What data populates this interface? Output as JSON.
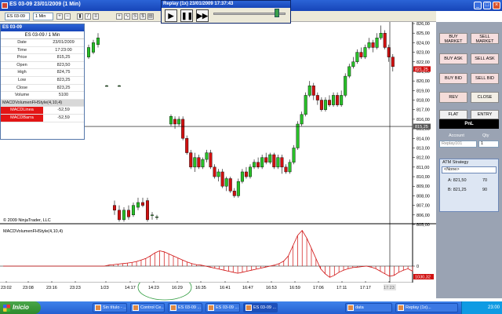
{
  "window": {
    "title": "ES 03-09  23/01/2009  (1 Min)"
  },
  "toolbar": {
    "instrument": "ES 03-09",
    "interval": "1 Min"
  },
  "replay": {
    "title": "Replay (1x) 23/01/2009 17:37:43",
    "progress": 0.85
  },
  "databox": {
    "title": "ES 03-09",
    "subtitle": "ES 03-09 / 1 Min",
    "rows": [
      {
        "k": "Date",
        "v": "23/01/2009"
      },
      {
        "k": "Time",
        "v": "17:23:00"
      },
      {
        "k": "Price",
        "v": "815,25"
      },
      {
        "k": "Open",
        "v": "823,50"
      },
      {
        "k": "High",
        "v": "824,75"
      },
      {
        "k": "Low",
        "v": "823,25"
      },
      {
        "k": "Close",
        "v": "823,25"
      },
      {
        "k": "Volume",
        "v": "5100"
      },
      {
        "k": "MACDVolumenFHStyle(4,10,4)",
        "v": ""
      },
      {
        "k": "MACDLinea",
        "v": "-52,59"
      },
      {
        "k": "MACDBarra",
        "v": "-52,59"
      }
    ]
  },
  "chart": {
    "copyright": "© 2009 NinjaTrader, LLC",
    "indicator_label": "MACDVolumenFHStyle(4,10,4)",
    "price_labels": [
      "826,00",
      "825,00",
      "824,00",
      "823,00",
      "822,00",
      "821,00",
      "820,00",
      "819,00",
      "818,00",
      "817,00",
      "816,00",
      "815,00",
      "814,00",
      "813,00",
      "812,00",
      "811,00",
      "810,00",
      "809,00",
      "808,00",
      "807,00",
      "806,00",
      "805,00"
    ],
    "current_price_tag": "821,25",
    "crosshair_price_tag": "815,25",
    "indicator_tag": "1030,32",
    "indicator_zero_label": "0",
    "time_labels": [
      "23:02",
      "23:08",
      "23:16",
      "23:23",
      "1/23",
      "14:17",
      "14:23",
      "16:29",
      "16:35",
      "16:41",
      "16:47",
      "16:53",
      "16:59",
      "17:06",
      "17:11",
      "17:17",
      "17:23"
    ]
  },
  "chart_data": {
    "type": "candlestick",
    "ylim": [
      805,
      826
    ],
    "candles": [
      {
        "o": 822.5,
        "c": 823.5,
        "h": 823.8,
        "l": 822.3
      },
      {
        "o": 823.0,
        "c": 824.0,
        "h": 824.3,
        "l": 822.8
      },
      {
        "o": 823.8,
        "c": 824.5,
        "h": 825.0,
        "l": 823.5
      },
      {
        "o": 819.5,
        "c": 819.5,
        "h": 819.6,
        "l": 819.4
      },
      {
        "o": 819.5,
        "c": 819.5,
        "h": 819.6,
        "l": 819.4
      },
      {
        "o": 807.0,
        "c": 806.5,
        "h": 807.5,
        "l": 806.0
      },
      {
        "o": 806.5,
        "c": 805.5,
        "h": 807.0,
        "l": 805.3
      },
      {
        "o": 805.5,
        "c": 806.5,
        "h": 806.8,
        "l": 805.3
      },
      {
        "o": 806.5,
        "c": 805.8,
        "h": 807.0,
        "l": 805.5
      },
      {
        "o": 806.0,
        "c": 807.0,
        "h": 807.3,
        "l": 805.8
      },
      {
        "o": 806.8,
        "c": 807.3,
        "h": 807.8,
        "l": 806.5
      },
      {
        "o": 807.3,
        "c": 807.0,
        "h": 807.8,
        "l": 806.8
      },
      {
        "o": 807.5,
        "c": 805.5,
        "h": 807.8,
        "l": 805.3
      },
      {
        "o": 806.0,
        "c": 806.0,
        "h": 806.3,
        "l": 805.5
      },
      {
        "o": 805.8,
        "c": 805.8,
        "h": 806.0,
        "l": 805.5
      },
      {
        "o": 815.5,
        "c": 816.3,
        "h": 816.5,
        "l": 815.3
      },
      {
        "o": 816.0,
        "c": 815.5,
        "h": 816.3,
        "l": 815.0
      },
      {
        "o": 815.5,
        "c": 816.0,
        "h": 816.3,
        "l": 815.3
      },
      {
        "o": 816.0,
        "c": 814.0,
        "h": 816.3,
        "l": 813.8
      },
      {
        "o": 814.0,
        "c": 812.5,
        "h": 814.3,
        "l": 812.3
      },
      {
        "o": 812.5,
        "c": 811.0,
        "h": 812.8,
        "l": 810.8
      },
      {
        "o": 811.0,
        "c": 812.0,
        "h": 812.5,
        "l": 810.5
      },
      {
        "o": 812.0,
        "c": 811.0,
        "h": 812.3,
        "l": 810.8
      },
      {
        "o": 811.0,
        "c": 811.8,
        "h": 812.0,
        "l": 810.8
      },
      {
        "o": 811.8,
        "c": 812.5,
        "h": 812.8,
        "l": 811.5
      },
      {
        "o": 812.5,
        "c": 811.0,
        "h": 812.8,
        "l": 810.8
      },
      {
        "o": 811.0,
        "c": 810.0,
        "h": 811.3,
        "l": 809.8
      },
      {
        "o": 810.0,
        "c": 810.5,
        "h": 810.8,
        "l": 809.5
      },
      {
        "o": 810.5,
        "c": 809.0,
        "h": 810.8,
        "l": 808.8
      },
      {
        "o": 809.0,
        "c": 809.8,
        "h": 810.0,
        "l": 808.5
      },
      {
        "o": 809.8,
        "c": 808.5,
        "h": 810.0,
        "l": 808.3
      },
      {
        "o": 808.5,
        "c": 808.0,
        "h": 808.8,
        "l": 807.8
      },
      {
        "o": 808.0,
        "c": 809.5,
        "h": 809.8,
        "l": 807.8
      },
      {
        "o": 809.5,
        "c": 810.5,
        "h": 810.8,
        "l": 809.3
      },
      {
        "o": 810.5,
        "c": 810.0,
        "h": 811.0,
        "l": 809.8
      },
      {
        "o": 810.0,
        "c": 811.0,
        "h": 811.3,
        "l": 809.8
      },
      {
        "o": 811.0,
        "c": 811.5,
        "h": 811.8,
        "l": 810.8
      },
      {
        "o": 811.5,
        "c": 811.0,
        "h": 812.0,
        "l": 810.8
      },
      {
        "o": 811.0,
        "c": 812.0,
        "h": 812.3,
        "l": 810.8
      },
      {
        "o": 812.0,
        "c": 811.5,
        "h": 812.5,
        "l": 811.3
      },
      {
        "o": 811.5,
        "c": 812.3,
        "h": 812.5,
        "l": 811.3
      },
      {
        "o": 812.3,
        "c": 811.0,
        "h": 812.5,
        "l": 810.8
      },
      {
        "o": 811.0,
        "c": 812.0,
        "h": 812.3,
        "l": 810.8
      },
      {
        "o": 812.0,
        "c": 811.0,
        "h": 812.3,
        "l": 810.3
      },
      {
        "o": 811.0,
        "c": 810.5,
        "h": 811.3,
        "l": 810.3
      },
      {
        "o": 810.5,
        "c": 811.5,
        "h": 811.8,
        "l": 810.3
      },
      {
        "o": 811.5,
        "c": 813.0,
        "h": 813.3,
        "l": 811.3
      },
      {
        "o": 813.0,
        "c": 815.5,
        "h": 815.8,
        "l": 812.8
      },
      {
        "o": 815.5,
        "c": 816.5,
        "h": 816.8,
        "l": 815.3
      },
      {
        "o": 816.5,
        "c": 818.5,
        "h": 818.8,
        "l": 816.3
      },
      {
        "o": 818.5,
        "c": 819.5,
        "h": 820.0,
        "l": 818.3
      },
      {
        "o": 819.5,
        "c": 818.5,
        "h": 819.8,
        "l": 818.0
      },
      {
        "o": 818.5,
        "c": 818.0,
        "h": 818.8,
        "l": 817.5
      },
      {
        "o": 818.0,
        "c": 817.0,
        "h": 818.3,
        "l": 816.8
      },
      {
        "o": 817.0,
        "c": 818.0,
        "h": 818.3,
        "l": 816.8
      },
      {
        "o": 818.0,
        "c": 817.5,
        "h": 818.5,
        "l": 817.3
      },
      {
        "o": 817.5,
        "c": 818.5,
        "h": 818.8,
        "l": 817.3
      },
      {
        "o": 818.5,
        "c": 817.5,
        "h": 818.8,
        "l": 817.3
      },
      {
        "o": 817.5,
        "c": 818.5,
        "h": 819.0,
        "l": 817.3
      },
      {
        "o": 818.5,
        "c": 820.5,
        "h": 820.8,
        "l": 818.3
      },
      {
        "o": 820.5,
        "c": 821.5,
        "h": 821.8,
        "l": 820.3
      },
      {
        "o": 821.5,
        "c": 822.0,
        "h": 822.5,
        "l": 821.3
      },
      {
        "o": 822.0,
        "c": 823.0,
        "h": 823.3,
        "l": 821.8
      },
      {
        "o": 823.0,
        "c": 822.5,
        "h": 823.5,
        "l": 822.3
      },
      {
        "o": 822.5,
        "c": 823.5,
        "h": 823.8,
        "l": 822.3
      },
      {
        "o": 823.5,
        "c": 824.0,
        "h": 824.5,
        "l": 823.3
      },
      {
        "o": 824.0,
        "c": 823.5,
        "h": 824.3,
        "l": 823.0
      },
      {
        "o": 823.5,
        "c": 824.5,
        "h": 825.0,
        "l": 823.3
      },
      {
        "o": 824.5,
        "c": 825.0,
        "h": 825.8,
        "l": 824.3
      },
      {
        "o": 825.0,
        "c": 823.5,
        "h": 825.3,
        "l": 823.3
      },
      {
        "o": 823.5,
        "c": 822.5,
        "h": 823.8,
        "l": 822.0
      },
      {
        "o": 822.5,
        "c": 821.5,
        "h": 822.8,
        "l": 821.0
      }
    ],
    "macd": [
      0,
      0,
      0,
      0,
      0,
      0,
      0,
      0,
      0,
      0,
      0,
      0,
      0,
      0,
      0,
      0,
      0,
      0,
      0,
      0,
      0,
      0,
      0,
      2,
      3,
      4,
      5,
      6,
      7,
      9,
      12,
      15,
      20,
      26,
      30,
      28,
      24,
      20,
      16,
      12,
      8,
      5,
      3,
      2,
      0,
      -2,
      -4,
      -6,
      -8,
      -10,
      -12,
      -14,
      -12,
      -10,
      -8,
      -6,
      -4,
      -2,
      0,
      2,
      5,
      10,
      20,
      40,
      60,
      70,
      55,
      35,
      15,
      -5,
      -15,
      -22,
      -18,
      -12,
      -8,
      -5,
      -3,
      -2,
      -1,
      0,
      -2,
      -5,
      -10,
      -15,
      -20,
      -18,
      -12,
      -8,
      -5,
      -10
    ]
  },
  "panel": {
    "buy_market": "BUY\nMARKET",
    "sell_market": "SELL\nMARKET",
    "buy_ask": "BUY ASK",
    "sell_ask": "SELL ASK",
    "buy_bid": "BUY BID",
    "sell_bid": "SELL BID",
    "rev": "REV",
    "close": "CLOSE",
    "flat": "FLAT",
    "entry": "ENTRY",
    "pnl": "PnL",
    "account_label": "Account",
    "qty_label": "Qty",
    "account_value": "Replay101",
    "qty_value": "1",
    "atm_title": "ATM Strategy",
    "atm_select": "<None>",
    "ask_label": "A: 821,50",
    "ask_size": "70",
    "bid_label": "B: 821,25",
    "bid_size": "90"
  },
  "taskbar": {
    "start": "Inicio",
    "tasks": [
      "Sin título - ...",
      "Control Ce...",
      "ES 03-09 ...",
      "ES 03-09 ...",
      "ES 03-09 ...",
      "data",
      "Replay (1x)..."
    ],
    "clock": "23:00"
  }
}
